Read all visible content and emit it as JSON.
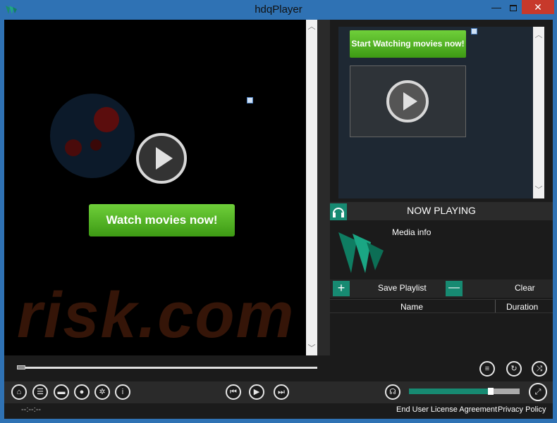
{
  "window": {
    "title": "hdqPlayer",
    "minimize": "—",
    "close": "✕"
  },
  "video": {
    "watch_button": "Watch movies now!",
    "watermark": "risk.com"
  },
  "ad": {
    "start_button": "Start Watching movies now!"
  },
  "now_playing": {
    "title": "NOW PLAYING",
    "media_info": "Media info"
  },
  "playlist": {
    "add_glyph": "+",
    "save_label": "Save Playlist",
    "remove_glyph": "—",
    "clear_label": "Clear",
    "columns": {
      "name": "Name",
      "duration": "Duration"
    },
    "rows": []
  },
  "playback": {
    "time": "--:--:--",
    "volume_fraction": 0.74
  },
  "footer": {
    "eula": "End User License Agreement",
    "privacy": "Privacy Policy"
  },
  "colors": {
    "accent": "#178a72",
    "frame": "#2f72b4",
    "close": "#c7392b",
    "button_green": "#4fb41f"
  },
  "icons": [
    "app-logo-icon",
    "play-icon",
    "headphones-icon",
    "home-icon",
    "list-icon",
    "folder-icon",
    "record-icon",
    "settings-icon",
    "info-icon",
    "previous-icon",
    "next-icon",
    "lyrics-icon",
    "repeat-icon",
    "shuffle-icon",
    "fullscreen-icon"
  ]
}
